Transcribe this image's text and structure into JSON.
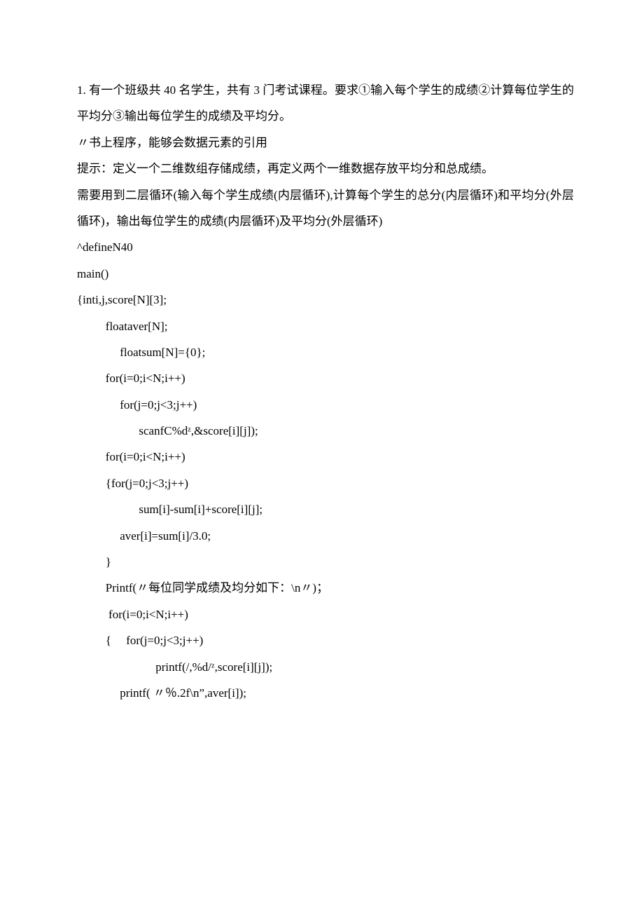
{
  "lines": {
    "p1": "1. 有一个班级共 40 名学生，共有 3 门考试课程。要求①输入每个学生的成绩②计算每位学生的平均分③输出每位学生的成绩及平均分。",
    "p2": "〃书上程序，能够会数据元素的引用",
    "p3": "提示：定义一个二维数组存储成绩，再定义两个一维数据存放平均分和总成绩。",
    "p4": "需要用到二层循环(输入每个学生成绩(内层循环),计算每个学生的总分(内层循环)和平均分(外层循环)，输出每位学生的成绩(内层循环)及平均分(外层循环)",
    "c1": "^defineN40",
    "c2": "main()",
    "c3": "{inti,j,score[N][3];",
    "c4": "floataver[N];",
    "c5": "floatsum[N]={0};",
    "c6": "for(i=0;i<N;i++)",
    "c7": "for(j=0;j<3;j++)",
    "c8": "scanfC%dᶻ,&score[i][j]);",
    "c9": "for(i=0;i<N;i++)",
    "c10": "{for(j=0;j<3;j++)",
    "c11": "sum[i]-sum[i]+score[i][j];",
    "c12": "aver[i]=sum[i]/3.0;",
    "c13": "}",
    "c14": "Printf(〃每位同学成绩及均分如下：\\n〃)；",
    "c15": " for(i=0;i<N;i++)",
    "c16": "{     for(j=0;j<3;j++)",
    "c17": "printf(/,%d/ᶻ,score[i][j]);",
    "c18": "printf( 〃％.2f\\n”,aver[i]);"
  }
}
